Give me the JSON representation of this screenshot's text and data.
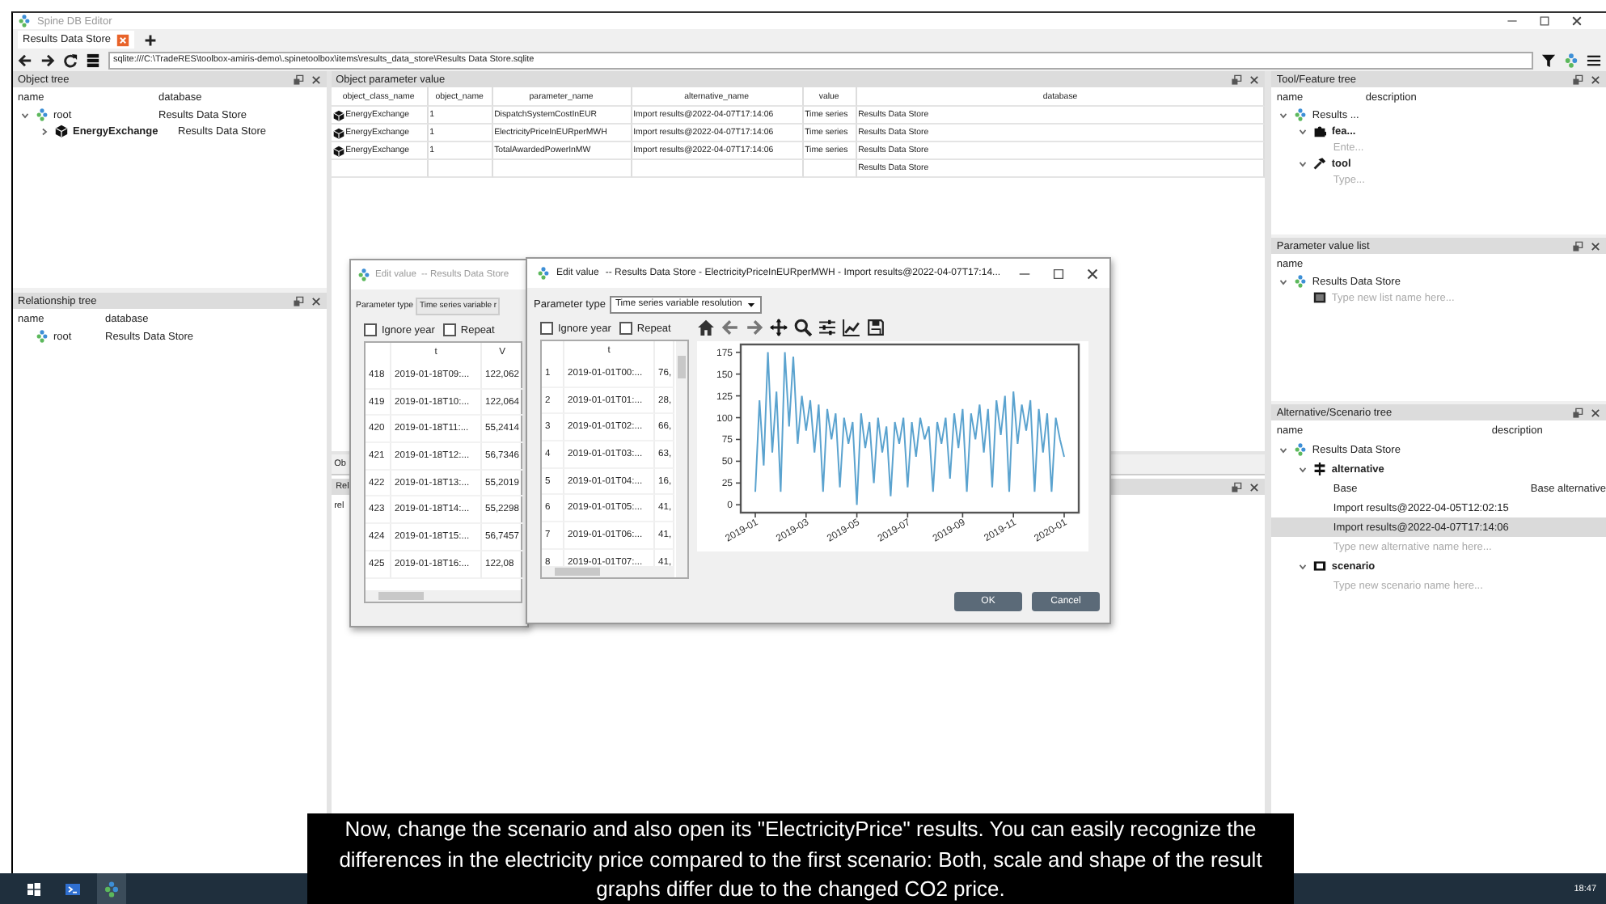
{
  "window": {
    "title": "Spine DB Editor"
  },
  "tabs": [
    {
      "label": "Results Data Store",
      "selected": true
    }
  ],
  "url": "sqlite:///C:\\TradeRES\\toolbox-amiris-demo\\.spinetoolbox\\items\\results_data_store\\Results Data Store.sqlite",
  "object_tree": {
    "title": "Object tree",
    "columns": [
      "name",
      "database"
    ],
    "items": [
      {
        "label": "root",
        "kind": "db",
        "database": "Results Data Store",
        "expanded": true,
        "children": [
          {
            "label": "EnergyExchange",
            "kind": "object_class",
            "database": "Results Data Store",
            "expanded": false
          }
        ]
      }
    ]
  },
  "relationship_tree": {
    "title": "Relationship tree",
    "columns": [
      "name",
      "database"
    ],
    "items": [
      {
        "label": "root",
        "kind": "db",
        "database": "Results Data Store"
      }
    ]
  },
  "object_parameter_value": {
    "title": "Object parameter value",
    "columns": [
      "object_class_name",
      "object_name",
      "parameter_name",
      "alternative_name",
      "value",
      "database"
    ],
    "rows": [
      {
        "object_class_name": "EnergyExchange",
        "object_name": "1",
        "parameter_name": "DispatchSystemCostInEUR",
        "alternative_name": "Import results@2022-04-07T17:14:06",
        "value": "Time series",
        "database": "Results Data Store"
      },
      {
        "object_class_name": "EnergyExchange",
        "object_name": "1",
        "parameter_name": "ElectricityPriceInEURperMWH",
        "alternative_name": "Import results@2022-04-07T17:14:06",
        "value": "Time series",
        "database": "Results Data Store"
      },
      {
        "object_class_name": "EnergyExchange",
        "object_name": "1",
        "parameter_name": "TotalAwardedPowerInMW",
        "alternative_name": "Import results@2022-04-07T17:14:06",
        "value": "Time series",
        "database": "Results Data Store"
      },
      {
        "database": "Results Data Store"
      }
    ]
  },
  "bottom_panel": {
    "tab": "Ob",
    "title": "Rel",
    "column": "rel"
  },
  "tool_feature_tree": {
    "title": "Tool/Feature tree",
    "columns": [
      "name",
      "description"
    ],
    "items": [
      {
        "label": "Results ...",
        "kind": "db",
        "expanded": true,
        "children": [
          {
            "label": "fea...",
            "kind": "feature",
            "expanded": true,
            "children": [
              {
                "label": "Ente...",
                "kind": "placeholder"
              }
            ]
          },
          {
            "label": "tool",
            "kind": "tool",
            "expanded": true,
            "children": [
              {
                "label": "Type...",
                "kind": "placeholder"
              }
            ]
          }
        ]
      }
    ]
  },
  "parameter_value_list": {
    "title": "Parameter value list",
    "columns": [
      "name"
    ],
    "items": [
      {
        "label": "Results Data Store",
        "kind": "db",
        "expanded": true,
        "children": [
          {
            "label": "Type new list name here...",
            "kind": "new_list"
          }
        ]
      }
    ]
  },
  "alternative_scenario_tree": {
    "title": "Alternative/Scenario tree",
    "columns": [
      "name",
      "description"
    ],
    "items": [
      {
        "label": "Results Data Store",
        "kind": "db",
        "expanded": true,
        "children": [
          {
            "label": "alternative",
            "kind": "alternative",
            "expanded": true,
            "children": [
              {
                "label": "Base",
                "kind": "entry",
                "description": "Base alternative",
                "selected": false
              },
              {
                "label": "Import results@2022-04-05T12:02:15",
                "kind": "entry",
                "selected": false
              },
              {
                "label": "Import results@2022-04-07T17:14:06",
                "kind": "entry",
                "selected": true
              },
              {
                "label": "Type new alternative name here...",
                "kind": "placeholder",
                "selected": false
              }
            ]
          },
          {
            "label": "scenario",
            "kind": "scenario",
            "expanded": true,
            "children": [
              {
                "label": "Type new scenario name here...",
                "kind": "placeholder"
              }
            ]
          }
        ]
      }
    ]
  },
  "dialogs": [
    {
      "active": false,
      "title": "Edit value",
      "subtitle": "-- Results Data Store",
      "parameter_type_label": "Parameter type",
      "parameter_type": "Time series variable r",
      "options": [
        {
          "label": "Ignore year",
          "checked": false
        },
        {
          "label": "Repeat",
          "checked": false
        }
      ],
      "columns": [
        "t",
        "V"
      ],
      "rows": [
        {
          "index": "418",
          "t": "2019-01-18T09:...",
          "value": "122,062"
        },
        {
          "index": "419",
          "t": "2019-01-18T10:...",
          "value": "122,064"
        },
        {
          "index": "420",
          "t": "2019-01-18T11:...",
          "value": "55,2414"
        },
        {
          "index": "421",
          "t": "2019-01-18T12:...",
          "value": "56,7346"
        },
        {
          "index": "422",
          "t": "2019-01-18T13:...",
          "value": "55,2019"
        },
        {
          "index": "423",
          "t": "2019-01-18T14:...",
          "value": "55,2298"
        },
        {
          "index": "424",
          "t": "2019-01-18T15:...",
          "value": "56,7457"
        },
        {
          "index": "425",
          "t": "2019-01-18T16:...",
          "value": "122,08"
        }
      ]
    },
    {
      "active": true,
      "title": "Edit value",
      "subtitle": "-- Results Data Store - ElectricityPriceInEURperMWH - Import results@2022-04-07T17:14...",
      "parameter_type_label": "Parameter type",
      "parameter_type": "Time series variable resolution",
      "options": [
        {
          "label": "Ignore year",
          "checked": false
        },
        {
          "label": "Repeat",
          "checked": false
        }
      ],
      "columns": [
        "t"
      ],
      "rows": [
        {
          "index": "1",
          "t": "2019-01-01T00:...",
          "value": "76,"
        },
        {
          "index": "2",
          "t": "2019-01-01T01:...",
          "value": "28,"
        },
        {
          "index": "3",
          "t": "2019-01-01T02:...",
          "value": "66,"
        },
        {
          "index": "4",
          "t": "2019-01-01T03:...",
          "value": "63,"
        },
        {
          "index": "5",
          "t": "2019-01-01T04:...",
          "value": "16,"
        },
        {
          "index": "6",
          "t": "2019-01-01T05:...",
          "value": "41,"
        },
        {
          "index": "7",
          "t": "2019-01-01T06:...",
          "value": "41,"
        },
        {
          "index": "8",
          "t": "2019-01-01T07:...",
          "value": "41,"
        }
      ],
      "chart_data": {
        "type": "line",
        "ylim": [
          -9,
          184
        ],
        "yticks": [
          0,
          25,
          50,
          75,
          100,
          125,
          150,
          175
        ],
        "categories": [
          "2019-01",
          null,
          null,
          null,
          null,
          null,
          null,
          null,
          null,
          null,
          null,
          null,
          "2019-03",
          null,
          null,
          null,
          null,
          null,
          null,
          null,
          null,
          null,
          null,
          null,
          "2019-05",
          null,
          null,
          null,
          null,
          null,
          null,
          null,
          null,
          null,
          null,
          null,
          "2019-07",
          null,
          null,
          null,
          null,
          null,
          null,
          null,
          null,
          null,
          null,
          null,
          null,
          "2019-09",
          null,
          null,
          null,
          null,
          null,
          null,
          null,
          null,
          null,
          null,
          null,
          "2019-11",
          null,
          null,
          null,
          null,
          null,
          null,
          null,
          null,
          null,
          null,
          null,
          "2020-01"
        ],
        "series": [
          {
            "color": "#5ba3cf",
            "values": [
              15,
              120,
              45,
              175,
              60,
              130,
              15,
              175,
              90,
              170,
              70,
              125,
              85,
              120,
              60,
              115,
              15,
              110,
              75,
              105,
              20,
              100,
              70,
              95,
              0,
              105,
              65,
              95,
              25,
              100,
              60,
              90,
              10,
              95,
              70,
              100,
              20,
              95,
              55,
              100,
              75,
              90,
              15,
              95,
              70,
              100,
              30,
              105,
              65,
              110,
              15,
              105,
              75,
              115,
              60,
              110,
              20,
              120,
              80,
              125,
              15,
              130,
              70,
              115,
              85,
              120,
              15,
              110,
              60,
              105,
              15,
              100,
              75,
              55
            ]
          }
        ]
      },
      "buttons": [
        "OK",
        "Cancel"
      ]
    }
  ],
  "subtitle": "Now, change the scenario and also open its \"ElectricityPrice\" results. You can easily recognize the differences in the electricity price compared to the first scenario: Both, scale and shape of the result graphs differ due to the changed CO2 price.",
  "taskbar": {
    "items": [
      {
        "kind": "windows",
        "active": false
      },
      {
        "kind": "terminal",
        "active": false
      },
      {
        "kind": "logo",
        "active": true
      }
    ],
    "time": "18:47"
  }
}
